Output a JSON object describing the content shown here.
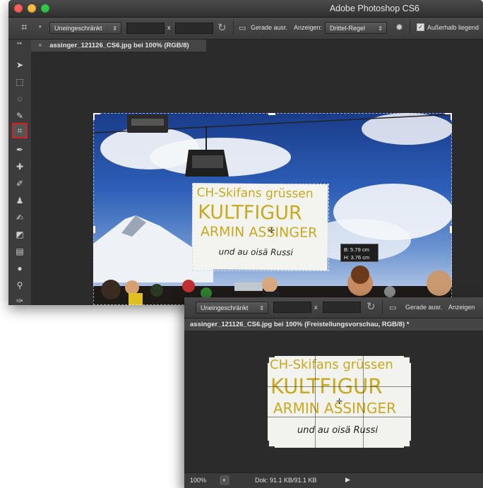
{
  "app_title": "Adobe Photoshop CS6",
  "options_bar": {
    "ratio_select": "Uneingeschränkt",
    "x_separator": "x",
    "straighten_label": "Gerade ausr.",
    "view_label": "Anzeigen:",
    "view_select": "Drittel-Regel",
    "delete_outside_label": "Außerhalb liegend"
  },
  "document_tab": {
    "close": "×",
    "title": "assinger_121126_CS6.jpg bei 100% (RGB/8)"
  },
  "crop_info": {
    "width": "B: 5.79 cm",
    "height": "H: 3.76 cm"
  },
  "banner_text": {
    "line1": "CH-Skifans grüssen",
    "line2": "KULTFIGUR",
    "line3": "ARMIN ASSINGER",
    "line4": "und au oisä Russi"
  },
  "front_window": {
    "ratio_select": "Uneingeschränkt",
    "x_separator": "x",
    "straighten_label": "Gerade ausr.",
    "view_label": "Anzeigen",
    "tab_title": "assinger_121126_CS6.jpg bei 100% (Freistellungsvorschau, RGB/8) *",
    "zoom": "100%",
    "doc_info": "Dok: 91.1 KB/91.1 KB"
  },
  "colors": {
    "ps_dark": "#2b2b2b",
    "ps_panel": "#3c3c3c",
    "active_tool_border": "#d42020",
    "banner_text": "#c9a91e",
    "traffic_red": "#fc605c",
    "traffic_yellow": "#fdbc40",
    "traffic_green": "#34c84a"
  }
}
